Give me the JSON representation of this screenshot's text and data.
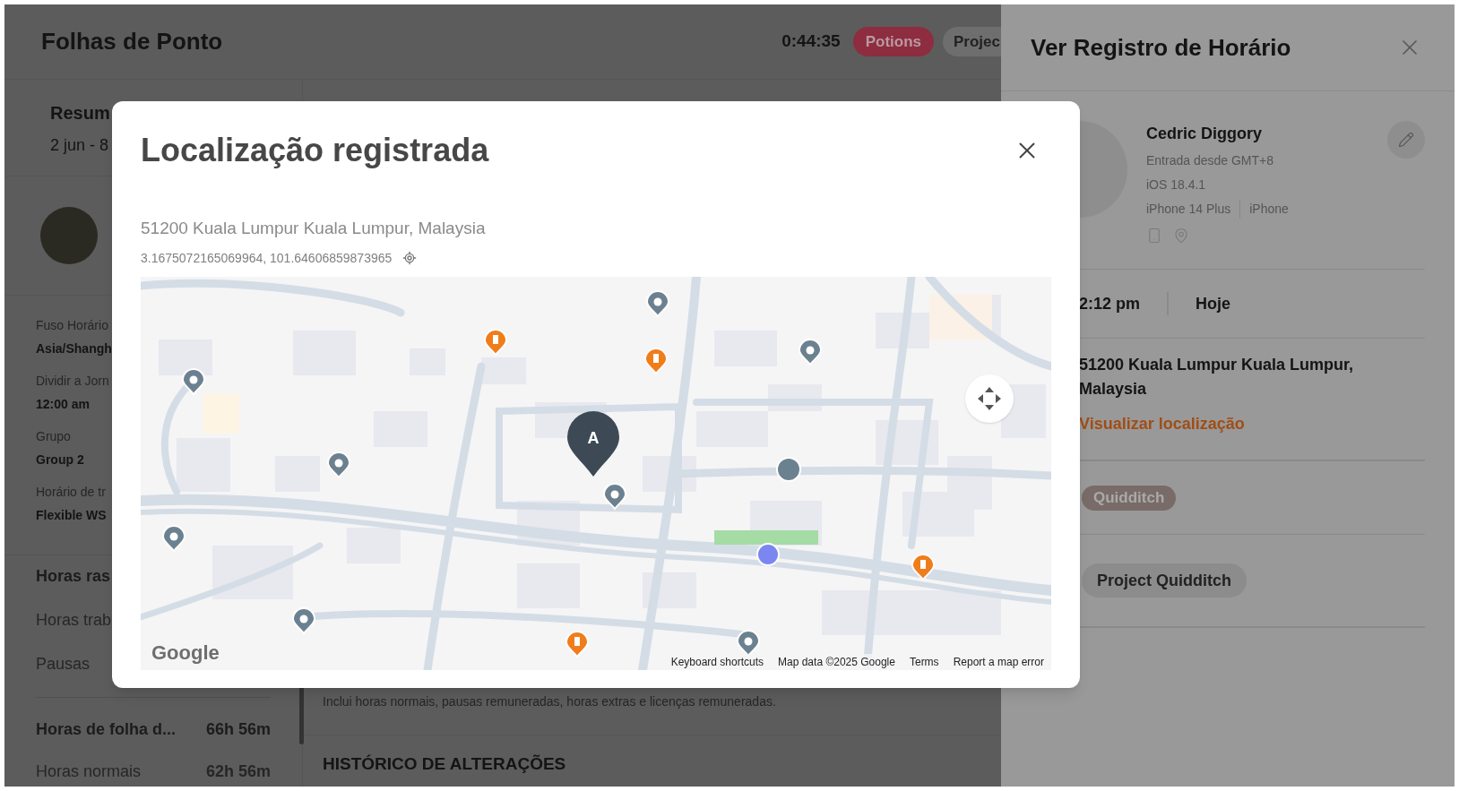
{
  "page": {
    "title": "Folhas de Ponto",
    "timer": "0:44:35",
    "header_tags": [
      {
        "label": "Potions",
        "color": "#8e2c40"
      },
      {
        "label": "Projec",
        "color": "#6e6e6e"
      }
    ],
    "summary": {
      "title": "Resum",
      "range": "2 jun - 8"
    },
    "details": [
      {
        "label": "Fuso Horário",
        "value": "Asia/Shangh"
      },
      {
        "label": "Dividir a Jorn",
        "value": "12:00 am"
      },
      {
        "label": "Grupo",
        "value": "Group 2"
      },
      {
        "label": "Horário de tr",
        "value": "Flexible WS"
      }
    ],
    "tracked": {
      "title": "Horas ras",
      "rows": [
        "Horas trab",
        "Pausas"
      ]
    },
    "payroll": {
      "title": "Horas de folha d...",
      "value": "66h 56m",
      "rows": [
        {
          "label": "Horas normais",
          "value": "62h 56m"
        }
      ]
    },
    "payroll_note": "Inclui horas normais, pausas remuneradas, horas extras e licenças remuneradas.",
    "history_title": "HISTÓRICO DE ALTERAÇÕES"
  },
  "side_panel": {
    "title": "Ver Registro de Horário",
    "name": "Cedric Diggory",
    "info": [
      "Entrada desde GMT+8",
      "iOS 18.4.1"
    ],
    "device": [
      "iPhone 14 Plus",
      "iPhone"
    ],
    "time": "2:12 pm",
    "day": "Hoje",
    "address": "51200 Kuala Lumpur Kuala Lumpur, Malaysia",
    "location_link": "Visualizar localização",
    "tag": "Quidditch",
    "project": "Project Quidditch"
  },
  "modal": {
    "title": "Localização registrada",
    "address": "51200 Kuala Lumpur Kuala Lumpur, Malaysia",
    "coordinates": "3.1675072165069964, 101.64606859873965",
    "map": {
      "marker": "A",
      "logo": "Google",
      "attribution": [
        "Keyboard shortcuts",
        "Map data ©2025 Google",
        "Terms",
        "Report a map error"
      ]
    }
  }
}
